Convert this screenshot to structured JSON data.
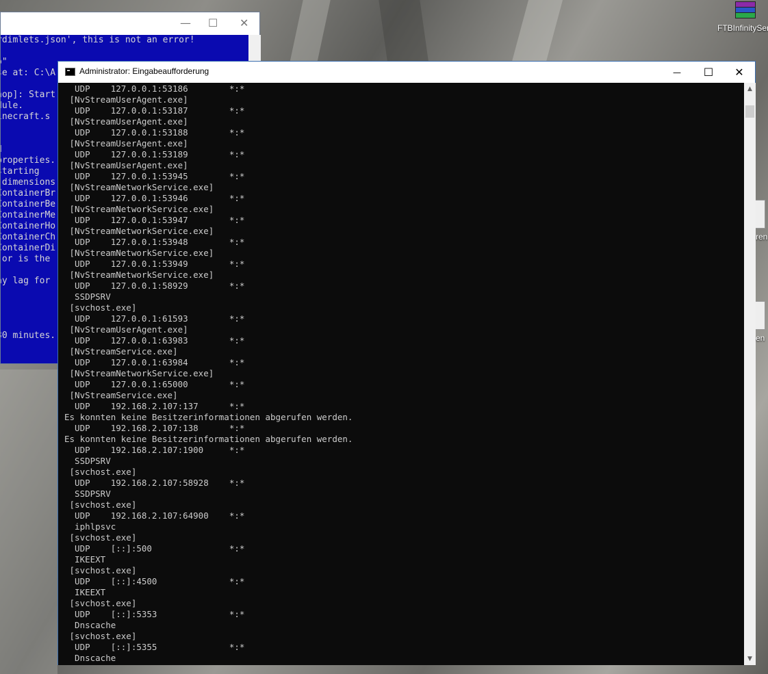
{
  "desktop": {
    "icons": [
      {
        "label": "FTBInfinitySer"
      }
    ],
    "side_labels": [
      "ren",
      "en"
    ]
  },
  "background_window": {
    "lines": [
      "rdimlets.json', this is not an error!",
      "",
      "o\"",
      "se at: C:\\A",
      "",
      "hop]: Start",
      "dule.",
      "inecraft.s",
      "",
      "",
      "d",
      "properties.",
      "starting",
      " dimensions",
      "ContainerBr",
      "ContainerBe",
      "ContainerMe",
      "ContainerHo",
      "ContainerCh",
      "ContainerDi",
      " or is the",
      "",
      "ay lag for",
      "",
      "",
      "",
      "",
      "30 minutes."
    ]
  },
  "main_window": {
    "title": "Administrator: Eingabeaufforderung",
    "controls": {
      "minimize": "—",
      "maximize": "☐",
      "close": "✕"
    },
    "lines": [
      "  UDP    127.0.0.1:53186        *:*",
      " [NvStreamUserAgent.exe]",
      "  UDP    127.0.0.1:53187        *:*",
      " [NvStreamUserAgent.exe]",
      "  UDP    127.0.0.1:53188        *:*",
      " [NvStreamUserAgent.exe]",
      "  UDP    127.0.0.1:53189        *:*",
      " [NvStreamUserAgent.exe]",
      "  UDP    127.0.0.1:53945        *:*",
      " [NvStreamNetworkService.exe]",
      "  UDP    127.0.0.1:53946        *:*",
      " [NvStreamNetworkService.exe]",
      "  UDP    127.0.0.1:53947        *:*",
      " [NvStreamNetworkService.exe]",
      "  UDP    127.0.0.1:53948        *:*",
      " [NvStreamNetworkService.exe]",
      "  UDP    127.0.0.1:53949        *:*",
      " [NvStreamNetworkService.exe]",
      "  UDP    127.0.0.1:58929        *:*",
      "  SSDPSRV",
      " [svchost.exe]",
      "  UDP    127.0.0.1:61593        *:*",
      " [NvStreamUserAgent.exe]",
      "  UDP    127.0.0.1:63983        *:*",
      " [NvStreamService.exe]",
      "  UDP    127.0.0.1:63984        *:*",
      " [NvStreamNetworkService.exe]",
      "  UDP    127.0.0.1:65000        *:*",
      " [NvStreamService.exe]",
      "  UDP    192.168.2.107:137      *:*",
      "Es konnten keine Besitzerinformationen abgerufen werden.",
      "  UDP    192.168.2.107:138      *:*",
      "Es konnten keine Besitzerinformationen abgerufen werden.",
      "  UDP    192.168.2.107:1900     *:*",
      "  SSDPSRV",
      " [svchost.exe]",
      "  UDP    192.168.2.107:58928    *:*",
      "  SSDPSRV",
      " [svchost.exe]",
      "  UDP    192.168.2.107:64900    *:*",
      "  iphlpsvc",
      " [svchost.exe]",
      "  UDP    [::]:500               *:*",
      "  IKEEXT",
      " [svchost.exe]",
      "  UDP    [::]:4500              *:*",
      "  IKEEXT",
      " [svchost.exe]",
      "  UDP    [::]:5353              *:*",
      "  Dnscache",
      " [svchost.exe]",
      "  UDP    [::]:5355              *:*",
      "  Dnscache"
    ]
  }
}
